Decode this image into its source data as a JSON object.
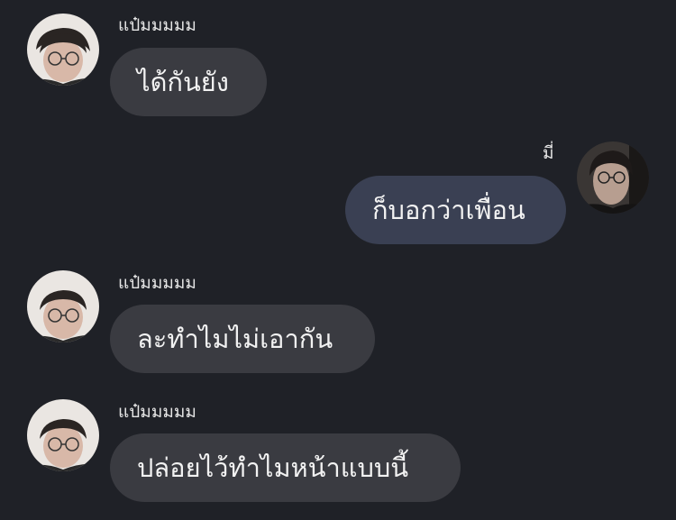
{
  "chat": {
    "messages": [
      {
        "sender": "แป๋มมมมม",
        "text": "ได้กันยัง",
        "direction": "incoming"
      },
      {
        "sender": "มี่",
        "text": "ก็บอกว่าเพื่อน",
        "direction": "outgoing"
      },
      {
        "sender": "แป๋มมมมม",
        "text": "ละทำไมไม่เอากัน",
        "direction": "incoming"
      },
      {
        "sender": "แป๋มมมมม",
        "text": "ปล่อยไว้ทำไมหน้าแบบนี้",
        "direction": "incoming"
      }
    ]
  },
  "colors": {
    "background": "#1f2127",
    "incoming_bubble": "#3a3b41",
    "outgoing_bubble": "#3a4053",
    "text": "#f2f2f2"
  }
}
